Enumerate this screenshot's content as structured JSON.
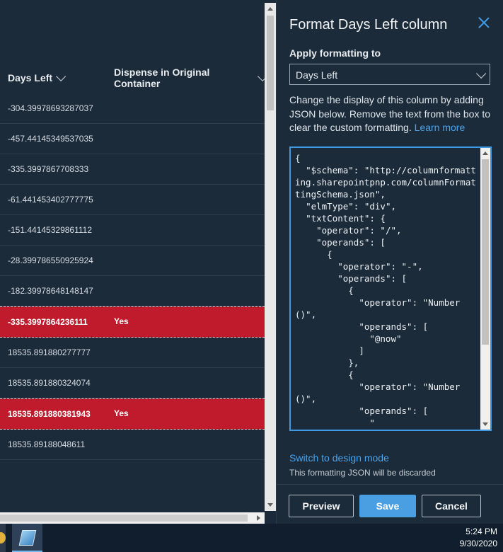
{
  "list": {
    "columns": [
      {
        "label": "Days Left"
      },
      {
        "label": "Dispense in Original Container"
      }
    ],
    "rows": [
      {
        "days": "-304.39978693287037",
        "dispense": "",
        "highlight": false
      },
      {
        "days": "-457.44145349537035",
        "dispense": "",
        "highlight": false
      },
      {
        "days": "-335.3997867708333",
        "dispense": "",
        "highlight": false
      },
      {
        "days": "-61.441453402777775",
        "dispense": "",
        "highlight": false
      },
      {
        "days": "-151.44145329861112",
        "dispense": "",
        "highlight": false
      },
      {
        "days": "-28.399786550925924",
        "dispense": "",
        "highlight": false
      },
      {
        "days": "-182.39978648148147",
        "dispense": "",
        "highlight": false
      },
      {
        "days": "-335.3997864236111",
        "dispense": "Yes",
        "highlight": true
      },
      {
        "days": "18535.891880277777",
        "dispense": "",
        "highlight": false
      },
      {
        "days": "18535.891880324074",
        "dispense": "",
        "highlight": false
      },
      {
        "days": "18535.891880381943",
        "dispense": "Yes",
        "highlight": true
      },
      {
        "days": "18535.89188048611",
        "dispense": "",
        "highlight": false
      }
    ],
    "highlight_color": "#c01b2c"
  },
  "panel": {
    "title": "Format Days Left column",
    "apply_label": "Apply formatting to",
    "apply_value": "Days Left",
    "description": "Change the display of this column by adding JSON below. Remove the text from the box to clear the custom formatting.",
    "learn_more": "Learn more",
    "json_text": "{\n  \"$schema\": \"http://columnformatting.sharepointpnp.com/columnFormattingSchema.json\",\n  \"elmType\": \"div\",\n  \"txtContent\": {\n    \"operator\": \"/\",\n    \"operands\": [\n      {\n        \"operator\": \"-\",\n        \"operands\": [\n          {\n            \"operator\": \"Number()\",\n            \"operands\": [\n              \"@now\"\n            ]\n          },\n          {\n            \"operator\": \"Number()\",\n            \"operands\": [\n              \"",
    "switch_mode": "Switch to design mode",
    "discard_note": "This formatting JSON will be discarded",
    "buttons": {
      "preview": "Preview",
      "save": "Save",
      "cancel": "Cancel"
    },
    "accent_color": "#4a9fe2"
  },
  "taskbar": {
    "time": "5:24 PM",
    "date": "9/30/2020"
  }
}
